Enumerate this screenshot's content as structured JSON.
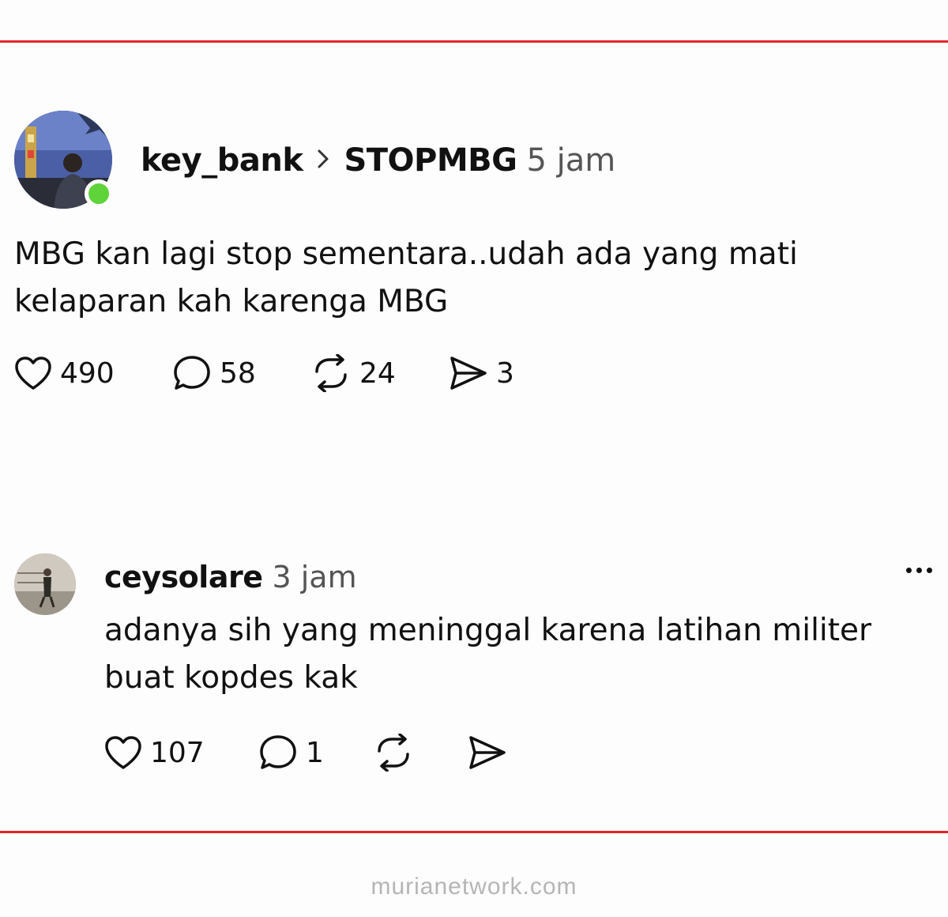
{
  "post": {
    "username": "key_bank",
    "community": "STOPMBG",
    "time": "5 jam",
    "body": "MBG kan lagi stop sementara..udah ada yang mati kelaparan kah karenga MBG",
    "likes": "490",
    "comments": "58",
    "reposts": "24",
    "shares": "3"
  },
  "reply": {
    "username": "ceysolare",
    "time": "3 jam",
    "body": "adanya sih yang meninggal karena latihan militer buat kopdes kak",
    "likes": "107",
    "comments": "1"
  },
  "watermark": "murianetwork.com",
  "colors": {
    "rule": "#e3262b",
    "online": "#5fd33a",
    "text": "#111111",
    "muted": "#555555"
  },
  "icons": [
    "heart-icon",
    "comment-icon",
    "repost-icon",
    "share-icon",
    "more-icon",
    "chevron-right-icon"
  ]
}
